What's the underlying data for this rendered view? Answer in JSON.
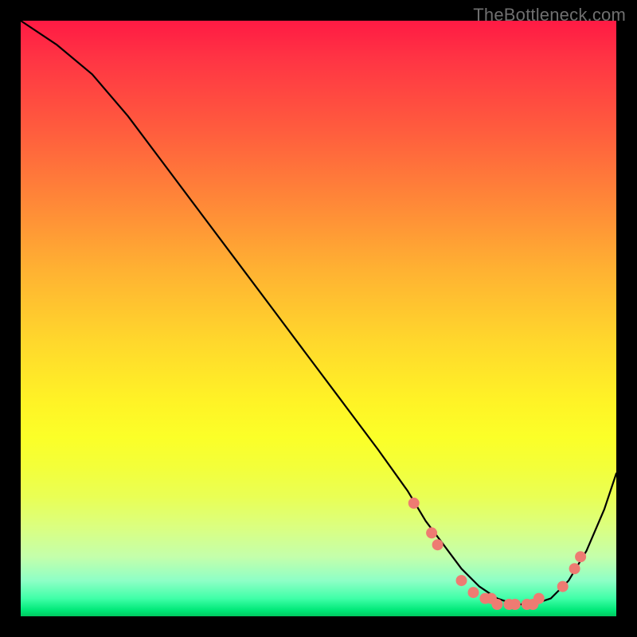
{
  "watermark": "TheBottleneck.com",
  "colors": {
    "marker": "#ee7b72",
    "curve": "#000000",
    "bg": "#000000"
  },
  "chart_data": {
    "type": "line",
    "title": "",
    "xlabel": "",
    "ylabel": "",
    "xlim": [
      0,
      100
    ],
    "ylim": [
      0,
      100
    ],
    "grid": false,
    "legend": false,
    "series": [
      {
        "name": "bottleneck-curve",
        "x": [
          0,
          6,
          12,
          18,
          24,
          30,
          36,
          42,
          48,
          54,
          60,
          65,
          68,
          71,
          74,
          77,
          80,
          83,
          86,
          89,
          92,
          95,
          98,
          100
        ],
        "y": [
          100,
          96,
          91,
          84,
          76,
          68,
          60,
          52,
          44,
          36,
          28,
          21,
          16,
          12,
          8,
          5,
          3,
          2,
          2,
          3,
          6,
          11,
          18,
          24
        ]
      }
    ],
    "markers": [
      {
        "x": 66,
        "y": 19
      },
      {
        "x": 69,
        "y": 14
      },
      {
        "x": 70,
        "y": 12
      },
      {
        "x": 74,
        "y": 6
      },
      {
        "x": 76,
        "y": 4
      },
      {
        "x": 78,
        "y": 3
      },
      {
        "x": 79,
        "y": 3
      },
      {
        "x": 80,
        "y": 2
      },
      {
        "x": 82,
        "y": 2
      },
      {
        "x": 83,
        "y": 2
      },
      {
        "x": 85,
        "y": 2
      },
      {
        "x": 86,
        "y": 2
      },
      {
        "x": 87,
        "y": 3
      },
      {
        "x": 91,
        "y": 5
      },
      {
        "x": 93,
        "y": 8
      },
      {
        "x": 94,
        "y": 10
      }
    ]
  }
}
